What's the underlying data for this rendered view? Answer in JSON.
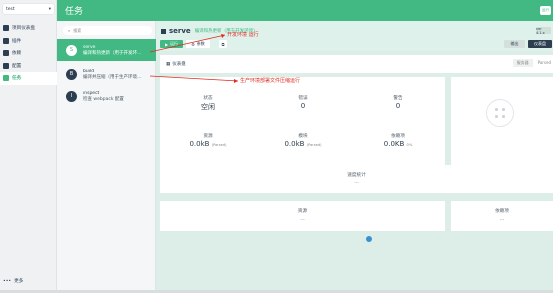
{
  "sidebar": {
    "project": "test",
    "items": [
      {
        "label": "项目仪表盘",
        "active": false
      },
      {
        "label": "插件",
        "active": false
      },
      {
        "label": "依赖",
        "active": false
      },
      {
        "label": "配置",
        "active": false
      },
      {
        "label": "任务",
        "active": true
      }
    ],
    "more": "更多"
  },
  "topbar": {
    "title": "任务",
    "btn": "运行"
  },
  "tasks": {
    "search_placeholder": "搜索",
    "items": [
      {
        "name": "serve",
        "desc": "编译和热更新（用于开发环...",
        "icon": "S",
        "selected": true
      },
      {
        "name": "build",
        "desc": "编译并压缩（用于生产环境...",
        "icon": "B",
        "selected": false
      },
      {
        "name": "inspect",
        "desc": "检查 webpack 配置",
        "icon": "I",
        "selected": false
      }
    ]
  },
  "detail": {
    "name": "serve",
    "desc": "编译和热更新（用于开发环境）",
    "run_label": "运行",
    "config_label": "参数",
    "output_label": "输出",
    "analyze_label": "仪表盘",
    "top_right": "ver 4.1.x",
    "dashboard_label": "仪表盘",
    "dashboard_right": "服务器",
    "dashboard_right2": "Parsed"
  },
  "stats": {
    "status": {
      "label": "状态",
      "value": "空闲"
    },
    "errors": {
      "label": "错误",
      "value": "0"
    },
    "warnings": {
      "label": "警告",
      "value": "0"
    },
    "assets": {
      "label": "资源",
      "value": "0.0kB",
      "sub": "(Parsed)"
    },
    "modules": {
      "label": "模块",
      "value": "0.0kB",
      "sub": "(Parsed)"
    },
    "deps": {
      "label": "依赖项",
      "value": "0.0KB",
      "sub": "0%"
    }
  },
  "sections": {
    "speed": {
      "label": "速度统计",
      "value": "..."
    },
    "assets": {
      "label": "资源",
      "value": "..."
    },
    "deps": {
      "label": "依赖项",
      "value": "..."
    },
    "bubble_value": "..."
  },
  "annotations": {
    "dev": "开发环境 运行",
    "prod": "生产环境部署文件压缩运行"
  }
}
